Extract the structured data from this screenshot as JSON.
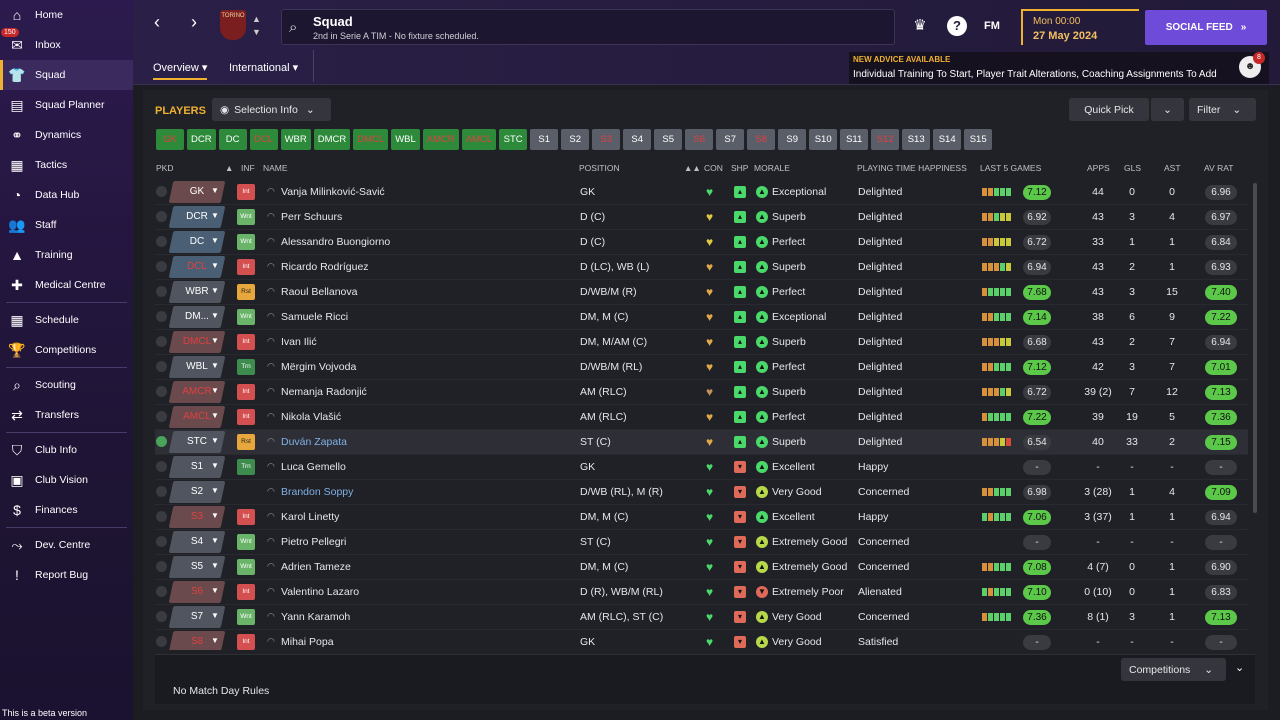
{
  "sidebar": {
    "items": [
      {
        "icon": "home-icon",
        "glyph": "⌂",
        "label": "Home"
      },
      {
        "icon": "inbox-icon",
        "glyph": "✉",
        "label": "Inbox",
        "badge": "150"
      },
      {
        "icon": "squad-icon",
        "glyph": "👕",
        "label": "Squad",
        "active": true
      },
      {
        "icon": "squad-planner-icon",
        "glyph": "▤",
        "label": "Squad Planner"
      },
      {
        "icon": "dynamics-icon",
        "glyph": "⚭",
        "label": "Dynamics"
      },
      {
        "icon": "tactics-icon",
        "glyph": "▦",
        "label": "Tactics"
      },
      {
        "icon": "data-hub-icon",
        "glyph": "◔",
        "label": "Data Hub"
      },
      {
        "icon": "staff-icon",
        "glyph": "👥",
        "label": "Staff"
      },
      {
        "icon": "training-icon",
        "glyph": "▲",
        "label": "Training"
      },
      {
        "icon": "medical-centre-icon",
        "glyph": "✚",
        "label": "Medical Centre"
      },
      {
        "sep": true
      },
      {
        "icon": "schedule-icon",
        "glyph": "▦",
        "label": "Schedule"
      },
      {
        "icon": "competitions-icon",
        "glyph": "🏆",
        "label": "Competitions"
      },
      {
        "sep": true
      },
      {
        "icon": "scouting-icon",
        "glyph": "⌕",
        "label": "Scouting"
      },
      {
        "icon": "transfers-icon",
        "glyph": "⇄",
        "label": "Transfers"
      },
      {
        "sep": true
      },
      {
        "icon": "club-info-icon",
        "glyph": "⛉",
        "label": "Club Info"
      },
      {
        "icon": "club-vision-icon",
        "glyph": "▣",
        "label": "Club Vision"
      },
      {
        "icon": "finances-icon",
        "glyph": "$",
        "label": "Finances"
      },
      {
        "sep": true
      },
      {
        "icon": "dev-centre-icon",
        "glyph": "⤳",
        "label": "Dev. Centre"
      },
      {
        "icon": "report-bug-icon",
        "glyph": "!",
        "label": "Report Bug"
      }
    ],
    "beta_text": "This is a beta version"
  },
  "topbar": {
    "crest_text": "TORINO",
    "title": "Squad",
    "subtitle": "2nd in Serie A TIM - No fixture scheduled.",
    "help_label": "?",
    "fm_label": "FM",
    "date_time": "Mon 00:00",
    "date": "27 May 2024",
    "social_feed": "SOCIAL FEED",
    "social_chevron": "»"
  },
  "subtabs": [
    "Overview",
    "International"
  ],
  "advice": {
    "heading": "NEW ADVICE AVAILABLE",
    "text": "Individual Training To Start, Player Trait Alterations, Coaching Assignments To Add",
    "count": "8"
  },
  "players_label": "PLAYERS",
  "selection_info": "Selection Info",
  "quick_pick": "Quick Pick",
  "filter": "Filter",
  "position_buttons": [
    {
      "l": "GK",
      "k": "red"
    },
    {
      "l": "DCR",
      "k": "g"
    },
    {
      "l": "DC",
      "k": "g"
    },
    {
      "l": "DCL",
      "k": "red"
    },
    {
      "l": "WBR",
      "k": "g"
    },
    {
      "l": "DMCR",
      "k": "g"
    },
    {
      "l": "DMCL",
      "k": "red"
    },
    {
      "l": "WBL",
      "k": "g"
    },
    {
      "l": "AMCR",
      "k": "red"
    },
    {
      "l": "AMCL",
      "k": "red"
    },
    {
      "l": "STC",
      "k": "g"
    },
    {
      "l": "S1",
      "k": "sub"
    },
    {
      "l": "S2",
      "k": "sub"
    },
    {
      "l": "S3",
      "k": "subred"
    },
    {
      "l": "S4",
      "k": "sub"
    },
    {
      "l": "S5",
      "k": "sub"
    },
    {
      "l": "S6",
      "k": "subred"
    },
    {
      "l": "S7",
      "k": "sub"
    },
    {
      "l": "S8",
      "k": "subred"
    },
    {
      "l": "S9",
      "k": "sub"
    },
    {
      "l": "S10",
      "k": "sub"
    },
    {
      "l": "S11",
      "k": "sub"
    },
    {
      "l": "S12",
      "k": "subred"
    },
    {
      "l": "S13",
      "k": "sub"
    },
    {
      "l": "S14",
      "k": "sub"
    },
    {
      "l": "S15",
      "k": "sub"
    }
  ],
  "columns": {
    "pkd": "PKD",
    "inf": "INF",
    "name": "NAME",
    "position": "POSITION",
    "con": "CON",
    "shp": "SHP",
    "morale": "MORALE",
    "pth": "PLAYING TIME HAPPINESS",
    "last5": "LAST 5 GAMES",
    "apps": "APPS",
    "gls": "GLS",
    "ast": "AST",
    "avrat": "AV RAT"
  },
  "players": [
    {
      "pos": "GK",
      "posStyle": "redbg",
      "inf": "Int",
      "name": "Vanja Milinković-Savić",
      "position": "GK",
      "con": "g",
      "shp": "g",
      "morIc": "g",
      "morale": "Exceptional",
      "pth": "Delighted",
      "bars": "ooggg",
      "r5": "7.12",
      "r5c": "g",
      "apps": "44",
      "gls": "0",
      "ast": "0",
      "av": "6.96",
      "avc": "n"
    },
    {
      "pos": "DCR",
      "posStyle": "blue",
      "inf": "Wnt",
      "name": "Perr Schuurs",
      "position": "D (C)",
      "con": "y",
      "shp": "g",
      "morIc": "g",
      "morale": "Superb",
      "pth": "Delighted",
      "bars": "oogyy",
      "r5": "6.92",
      "r5c": "n",
      "apps": "43",
      "gls": "3",
      "ast": "4",
      "av": "6.97",
      "avc": "n"
    },
    {
      "pos": "DC",
      "posStyle": "blue",
      "inf": "Wnt",
      "name": "Alessandro Buongiorno",
      "position": "D (C)",
      "con": "y",
      "shp": "g",
      "morIc": "g",
      "morale": "Perfect",
      "pth": "Delighted",
      "bars": "ooyyy",
      "r5": "6.72",
      "r5c": "n",
      "apps": "33",
      "gls": "1",
      "ast": "1",
      "av": "6.84",
      "avc": "n"
    },
    {
      "pos": "DCL",
      "posStyle": "blue red",
      "inf": "Int",
      "name": "Ricardo Rodríguez",
      "position": "D (LC), WB (L)",
      "con": "o",
      "shp": "g",
      "morIc": "g",
      "morale": "Superb",
      "pth": "Delighted",
      "bars": "ooogy",
      "r5": "6.94",
      "r5c": "n",
      "apps": "43",
      "gls": "2",
      "ast": "1",
      "av": "6.93",
      "avc": "n"
    },
    {
      "pos": "WBR",
      "posStyle": "gray",
      "inf": "Rst",
      "name": "Raoul Bellanova",
      "position": "D/WB/M (R)",
      "con": "o",
      "shp": "g",
      "morIc": "g",
      "morale": "Perfect",
      "pth": "Delighted",
      "bars": "ogggg",
      "r5": "7.68",
      "r5c": "g",
      "apps": "43",
      "gls": "3",
      "ast": "15",
      "av": "7.40",
      "avc": "g"
    },
    {
      "pos": "DM...",
      "posStyle": "gray",
      "inf": "Wnt",
      "name": "Samuele Ricci",
      "position": "DM, M (C)",
      "con": "o",
      "shp": "g",
      "morIc": "g",
      "morale": "Exceptional",
      "pth": "Delighted",
      "bars": "ooggg",
      "r5": "7.14",
      "r5c": "g",
      "apps": "38",
      "gls": "6",
      "ast": "9",
      "av": "7.22",
      "avc": "g"
    },
    {
      "pos": "DMCL",
      "posStyle": "redbg red",
      "inf": "Int",
      "name": "Ivan Ilić",
      "position": "DM, M/AM (C)",
      "con": "o",
      "shp": "g",
      "morIc": "g",
      "morale": "Superb",
      "pth": "Delighted",
      "bars": "oooyy",
      "r5": "6.68",
      "r5c": "n",
      "apps": "43",
      "gls": "2",
      "ast": "7",
      "av": "6.94",
      "avc": "n"
    },
    {
      "pos": "WBL",
      "posStyle": "gray",
      "inf": "Trn",
      "name": "Mërgim Vojvoda",
      "position": "D/WB/M (RL)",
      "con": "o",
      "shp": "g",
      "morIc": "g",
      "morale": "Perfect",
      "pth": "Delighted",
      "bars": "ooggg",
      "r5": "7.12",
      "r5c": "g",
      "apps": "42",
      "gls": "3",
      "ast": "7",
      "av": "7.01",
      "avc": "g"
    },
    {
      "pos": "AMCR",
      "posStyle": "redbg red",
      "inf": "Int",
      "name": "Nemanja Radonjić",
      "position": "AM (RLC)",
      "con": "b",
      "shp": "g",
      "morIc": "g",
      "morale": "Superb",
      "pth": "Delighted",
      "bars": "ooogy",
      "r5": "6.72",
      "r5c": "n",
      "apps": "39 (2)",
      "gls": "7",
      "ast": "12",
      "av": "7.13",
      "avc": "g"
    },
    {
      "pos": "AMCL",
      "posStyle": "redbg red",
      "inf": "Int",
      "name": "Nikola Vlašić",
      "position": "AM (RLC)",
      "con": "o",
      "shp": "g",
      "morIc": "g",
      "morale": "Perfect",
      "pth": "Delighted",
      "bars": "ogggg",
      "r5": "7.22",
      "r5c": "g",
      "apps": "39",
      "gls": "19",
      "ast": "5",
      "av": "7.36",
      "avc": "g"
    },
    {
      "pos": "STC",
      "posStyle": "gray",
      "inf": "Rst",
      "name": "Duván Zapata",
      "nameLink": true,
      "sel": true,
      "pk": true,
      "position": "ST (C)",
      "con": "o",
      "shp": "g",
      "morIc": "g",
      "morale": "Superb",
      "pth": "Delighted",
      "bars": "oooyr",
      "r5": "6.54",
      "r5c": "n",
      "apps": "40",
      "gls": "33",
      "ast": "2",
      "av": "7.15",
      "avc": "g"
    },
    {
      "pos": "S1",
      "posStyle": "gray",
      "inf": "Trn",
      "name": "Luca Gemello",
      "position": "GK",
      "con": "g",
      "shp": "r",
      "morIc": "g",
      "morale": "Excellent",
      "pth": "Happy",
      "bars": "",
      "r5": "-",
      "r5c": "d",
      "apps": "-",
      "gls": "-",
      "ast": "-",
      "av": "-",
      "avc": "d"
    },
    {
      "pos": "S2",
      "posStyle": "gray",
      "inf": "",
      "name": "Brandon Soppy",
      "nameLink": true,
      "position": "D/WB (RL), M (R)",
      "con": "g",
      "shp": "r",
      "morIc": "y",
      "morale": "Very Good",
      "pth": "Concerned",
      "bars": "ooggg",
      "r5": "6.98",
      "r5c": "n",
      "apps": "3 (28)",
      "gls": "1",
      "ast": "4",
      "av": "7.09",
      "avc": "g"
    },
    {
      "pos": "S3",
      "posStyle": "redbg red",
      "inf": "Int",
      "name": "Karol Linetty",
      "position": "DM, M (C)",
      "con": "g",
      "shp": "r",
      "morIc": "g",
      "morale": "Excellent",
      "pth": "Happy",
      "bars": "goggg",
      "r5": "7.06",
      "r5c": "g",
      "apps": "3 (37)",
      "gls": "1",
      "ast": "1",
      "av": "6.94",
      "avc": "n"
    },
    {
      "pos": "S4",
      "posStyle": "gray",
      "inf": "Wnt",
      "name": "Pietro Pellegri",
      "position": "ST (C)",
      "con": "g",
      "shp": "r",
      "morIc": "y",
      "morale": "Extremely Good",
      "pth": "Concerned",
      "bars": "",
      "r5": "-",
      "r5c": "d",
      "apps": "-",
      "gls": "-",
      "ast": "-",
      "av": "-",
      "avc": "d"
    },
    {
      "pos": "S5",
      "posStyle": "gray",
      "inf": "Wnt",
      "name": "Adrien Tameze",
      "position": "DM, M (C)",
      "con": "g",
      "shp": "r",
      "morIc": "y",
      "morale": "Extremely Good",
      "pth": "Concerned",
      "bars": "ooggg",
      "r5": "7.08",
      "r5c": "g",
      "apps": "4 (7)",
      "gls": "0",
      "ast": "1",
      "av": "6.90",
      "avc": "n"
    },
    {
      "pos": "S6",
      "posStyle": "redbg red",
      "inf": "Int",
      "name": "Valentino Lazaro",
      "position": "D (R), WB/M (RL)",
      "con": "g",
      "shp": "r",
      "morIc": "r",
      "morale": "Extremely Poor",
      "pth": "Alienated",
      "bars": "goggg",
      "r5": "7.10",
      "r5c": "g",
      "apps": "0 (10)",
      "gls": "0",
      "ast": "1",
      "av": "6.83",
      "avc": "n"
    },
    {
      "pos": "S7",
      "posStyle": "gray",
      "inf": "Wnt",
      "name": "Yann Karamoh",
      "position": "AM (RLC), ST (C)",
      "con": "g",
      "shp": "r",
      "morIc": "y",
      "morale": "Very Good",
      "pth": "Concerned",
      "bars": "ogggg",
      "r5": "7.36",
      "r5c": "g",
      "apps": "8 (1)",
      "gls": "3",
      "ast": "1",
      "av": "7.13",
      "avc": "g"
    },
    {
      "pos": "S8",
      "posStyle": "redbg red",
      "inf": "Int",
      "name": "Mihai Popa",
      "position": "GK",
      "con": "g",
      "shp": "r",
      "morIc": "y",
      "morale": "Very Good",
      "pth": "Satisfied",
      "bars": "",
      "r5": "-",
      "r5c": "d",
      "apps": "-",
      "gls": "-",
      "ast": "-",
      "av": "-",
      "avc": "d"
    }
  ],
  "footer": {
    "competitions": "Competitions",
    "no_match_day_rules": "No Match Day Rules"
  },
  "colors": {
    "accent": "#f0b030",
    "social": "#6e4bd8",
    "good": "#4bd86a",
    "bad": "#e06a5a"
  }
}
